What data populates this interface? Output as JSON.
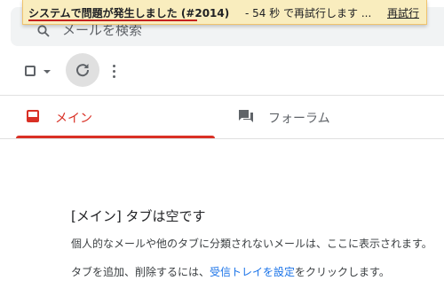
{
  "error_banner": {
    "message": "システムで問題が発生しました (#2014)",
    "countdown": "- 54 秒 で再試行します ...",
    "retry_label": "再試行"
  },
  "search": {
    "placeholder": "メールを検索"
  },
  "toolbar": {
    "icons": [
      "checkbox-icon",
      "chevron-down-icon",
      "refresh-icon",
      "more-vert-icon"
    ]
  },
  "tabs": [
    {
      "label": "メイン",
      "icon": "inbox-icon",
      "selected": true
    },
    {
      "label": "フォーラム",
      "icon": "forum-icon",
      "selected": false
    }
  ],
  "empty_state": {
    "title": "[メイン] タブは空です",
    "line1": "個人的なメールや他のタブに分類されないメールは、ここに表示されます。",
    "line2_before": "タブを追加、削除するには、",
    "line2_link": "受信トレイを設定",
    "line2_after": "をクリックします。"
  },
  "colors": {
    "accent_red": "#d93025",
    "link_blue": "#1a73e8",
    "banner_bg": "#f9edbe"
  }
}
